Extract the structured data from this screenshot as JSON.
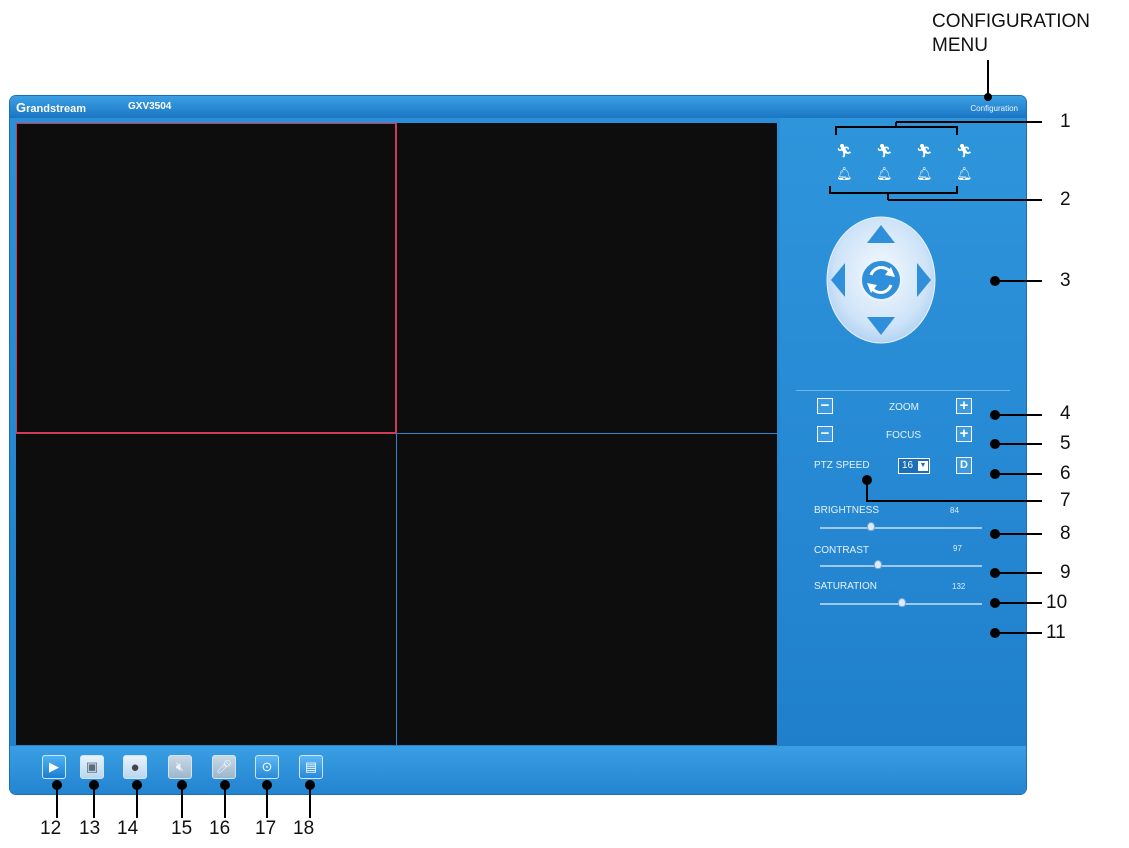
{
  "annotation": {
    "config_label_line1": "CONFIGURATION",
    "config_label_line2": "MENU",
    "right_numbers": [
      "1",
      "2",
      "3",
      "4",
      "5",
      "6",
      "7",
      "8",
      "9",
      "10",
      "11"
    ],
    "bottom_numbers": [
      "12",
      "13",
      "14",
      "15",
      "16",
      "17",
      "18"
    ]
  },
  "window": {
    "brand_first": "G",
    "brand_rest": "randstream",
    "model": "GXV3504",
    "config_link": "Configuration"
  },
  "side": {
    "zoom_label": "ZOOM",
    "focus_label": "FOCUS",
    "ptz_speed_label": "PTZ SPEED",
    "ptz_speed_value": "16",
    "default_button": "D",
    "brightness_label": "BRIGHTNESS",
    "brightness_value": "84",
    "contrast_label": "CONTRAST",
    "contrast_value": "97",
    "saturation_label": "SATURATION",
    "saturation_value": "132",
    "minus_symbol": "−",
    "plus_symbol": "+"
  },
  "icons": {
    "motion": "running-person-icon",
    "alarm": "bell-icon",
    "ptz": "ptz-direction-pad",
    "toolbar": [
      "play-icon",
      "camera-snapshot-icon",
      "record-icon",
      "speaker-mute-icon",
      "microphone-icon",
      "film-reel-icon",
      "save-icon"
    ]
  },
  "colors": {
    "app_blue": "#2688d3",
    "video_bg": "#0d0d0d",
    "pane_active_border": "#d23a5a",
    "pane_border": "#2b86cc"
  }
}
